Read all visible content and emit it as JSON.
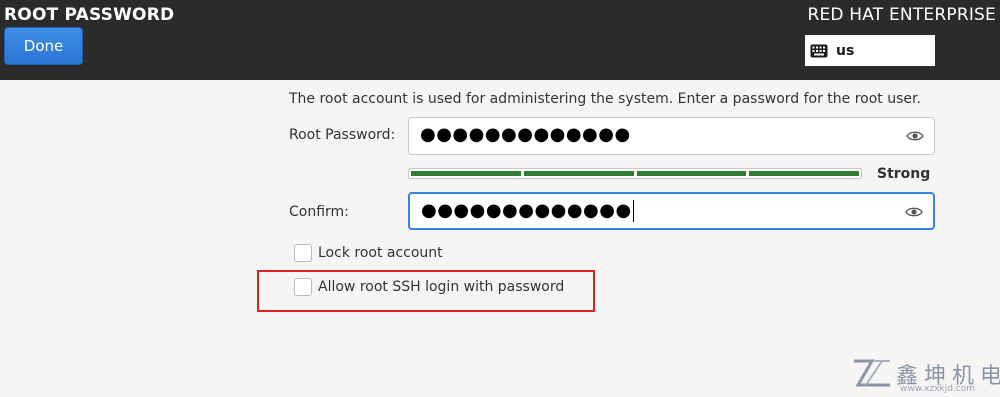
{
  "header": {
    "title": "ROOT PASSWORD",
    "done_label": "Done",
    "product": "RED HAT ENTERPRISE",
    "keyboard_layout": "us",
    "keyboard_icon": "keyboard-icon"
  },
  "main": {
    "description": "The root account is used for administering the system.  Enter a password for the root user.",
    "root_password": {
      "label": "Root Password:",
      "value": "●●●●●●●●●●●●●",
      "reveal_icon": "eye-icon"
    },
    "strength": {
      "label": "Strong",
      "level": 1.0,
      "color": "#2e7d32"
    },
    "confirm": {
      "label": "Confirm:",
      "value": "●●●●●●●●●●●●●",
      "reveal_icon": "eye-icon"
    },
    "lock_root": {
      "label": "Lock root account",
      "checked": false
    },
    "allow_ssh": {
      "label": "Allow root SSH login with password",
      "checked": false
    }
  },
  "annotation": {
    "highlight_color": "#e02020"
  },
  "watermark": {
    "text": "鑫坤机电",
    "url": "www.xzxkjd.com"
  },
  "colors": {
    "header_bg": "#2b2b2b",
    "accent": "#3584e4",
    "background": "#f6f5f4"
  }
}
